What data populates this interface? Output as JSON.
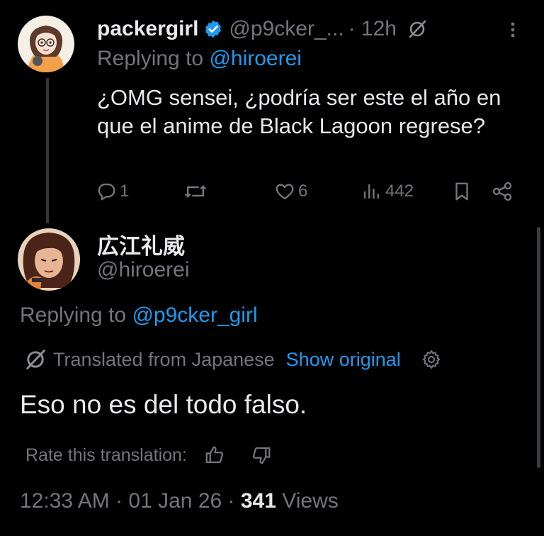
{
  "colors": {
    "background": "#000000",
    "text": "#e7e9ea",
    "muted": "#71767b",
    "link": "#1d9bf0",
    "verified": "#1d9bf0"
  },
  "tweet1": {
    "display_name": "packergirl",
    "handle_truncated": "@p9cker_...",
    "time": "· 12h",
    "replying_prefix": "Replying to",
    "replying_handle": "@hiroerei",
    "body": "¿OMG sensei, ¿podría ser este el año en que el anime de Black Lagoon regrese?",
    "replies": "1",
    "retweets": "",
    "likes": "6",
    "views": "442",
    "icons": [
      "verified-badge-icon",
      "grok-icon",
      "more-icon",
      "reply-icon",
      "retweet-icon",
      "like-icon",
      "views-icon",
      "bookmark-icon",
      "share-icon"
    ]
  },
  "tweet2": {
    "display_name": "広江礼威",
    "handle": "@hiroerei",
    "replying_prefix": "Replying to",
    "replying_handle": "@p9cker_girl",
    "translated_label": "Translated from Japanese",
    "show_original": "Show original",
    "body": "Eso no es del todo falso.",
    "rate_label": "Rate this translation:",
    "meta_prefix": "12:33 AM · 01 Jan 26 ·",
    "views_count": "341",
    "views_label": "Views",
    "icons": [
      "translate-icon",
      "settings-icon",
      "thumbs-up-icon",
      "thumbs-down-icon"
    ]
  }
}
